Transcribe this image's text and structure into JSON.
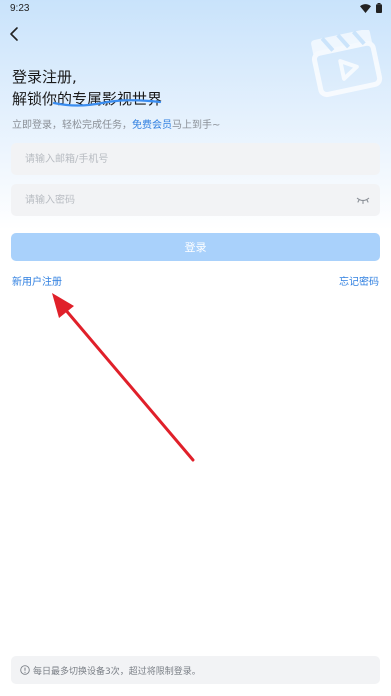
{
  "status_bar": {
    "time": "9:23",
    "icons": [
      "wifi-icon",
      "battery-icon"
    ]
  },
  "header": {
    "back_icon": "chevron-left-icon",
    "decor_icon": "video-clapper-icon"
  },
  "headline": {
    "line1": "登录注册,",
    "line2": "解锁你的专属影视世界"
  },
  "subtitle": {
    "prefix": "立即登录，轻松完成任务，",
    "link": "免费会员",
    "suffix": "马上到手~"
  },
  "form": {
    "account_placeholder": "请输入邮箱/手机号",
    "account_value": "",
    "password_placeholder": "请输入密码",
    "password_value": "",
    "password_toggle_icon": "eye-closed-icon",
    "login_label": "登录"
  },
  "links": {
    "register": "新用户注册",
    "forgot": "忘记密码"
  },
  "annotation": {
    "arrow_color": "#e0202a"
  },
  "notice": {
    "icon": "info-icon",
    "text": "每日最多切换设备3次，超过将限制登录。"
  },
  "colors": {
    "accent": "#2f7fe0",
    "button": "#a9d1fb"
  }
}
